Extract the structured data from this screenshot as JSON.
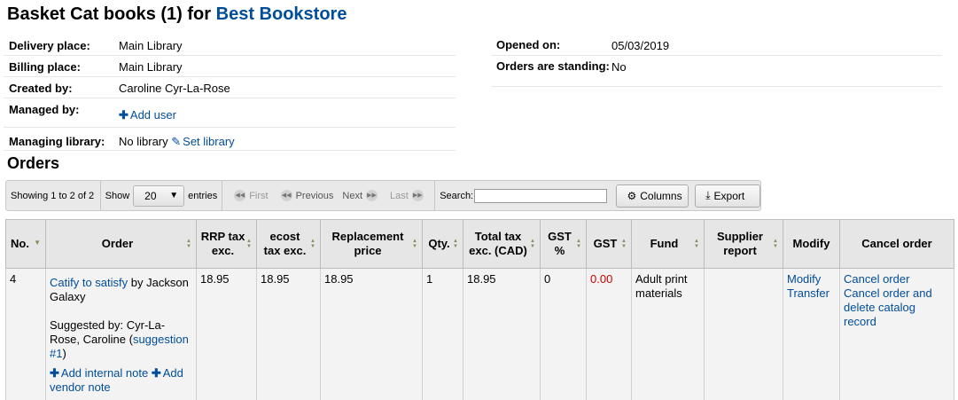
{
  "header": {
    "title_prefix": "Basket Cat books (1) for",
    "vendor": "Best Bookstore"
  },
  "basket_info": {
    "delivery_place_label": "Delivery place:",
    "delivery_place": "Main Library",
    "billing_place_label": "Billing place:",
    "billing_place": "Main Library",
    "created_by_label": "Created by:",
    "created_by": "Caroline Cyr-La-Rose",
    "managed_by_label": "Managed by:",
    "add_user": "Add user",
    "managing_library_label": "Managing library:",
    "managing_library": "No library",
    "set_library": "Set library",
    "opened_on_label": "Opened on:",
    "opened_on": "05/03/2019",
    "standing_label": "Orders are standing:",
    "standing": "No"
  },
  "orders": {
    "title": "Orders",
    "toolbar": {
      "info": "Showing 1 to 2 of 2",
      "show": "Show",
      "page_size": "20",
      "entries": "entries",
      "first": "First",
      "previous": "Previous",
      "next": "Next",
      "last": "Last",
      "search_label": "Search:",
      "columns": "Columns",
      "export": "Export"
    },
    "columns": {
      "no": "No.",
      "order": "Order",
      "rrp": "RRP tax exc.",
      "ecost": "ecost tax exc.",
      "replacement": "Replacement price",
      "qty": "Qty.",
      "total": "Total tax exc. (CAD)",
      "gst_pct": "GST %",
      "gst": "GST",
      "fund": "Fund",
      "supplier_report": "Supplier report",
      "modify": "Modify",
      "cancel": "Cancel order"
    },
    "row": {
      "no": "4",
      "title": "Catify to satisfy",
      "by": "by",
      "author": "Jackson Galaxy",
      "suggested_by": "Suggested by: Cyr-La-Rose, Caroline (",
      "suggestion_link": "suggestion #1",
      "suggested_close": ")",
      "add_internal_note": "Add internal note",
      "add_vendor_note": "Add vendor note",
      "rrp": "18.95",
      "ecost": "18.95",
      "replacement": "18.95",
      "qty": "1",
      "total": "18.95",
      "gst_pct": "0",
      "gst": "0.00",
      "fund": "Adult print materials",
      "supplier_report": "",
      "modify": "Modify",
      "transfer": "Transfer",
      "cancel_order": "Cancel order",
      "cancel_delete": "Cancel order and delete catalog record"
    }
  },
  "colors": {
    "link": "#004d99",
    "gst_value": "#cc0000",
    "header_bg": "#e6e6e6",
    "cell_bg": "#f3f3f3"
  }
}
